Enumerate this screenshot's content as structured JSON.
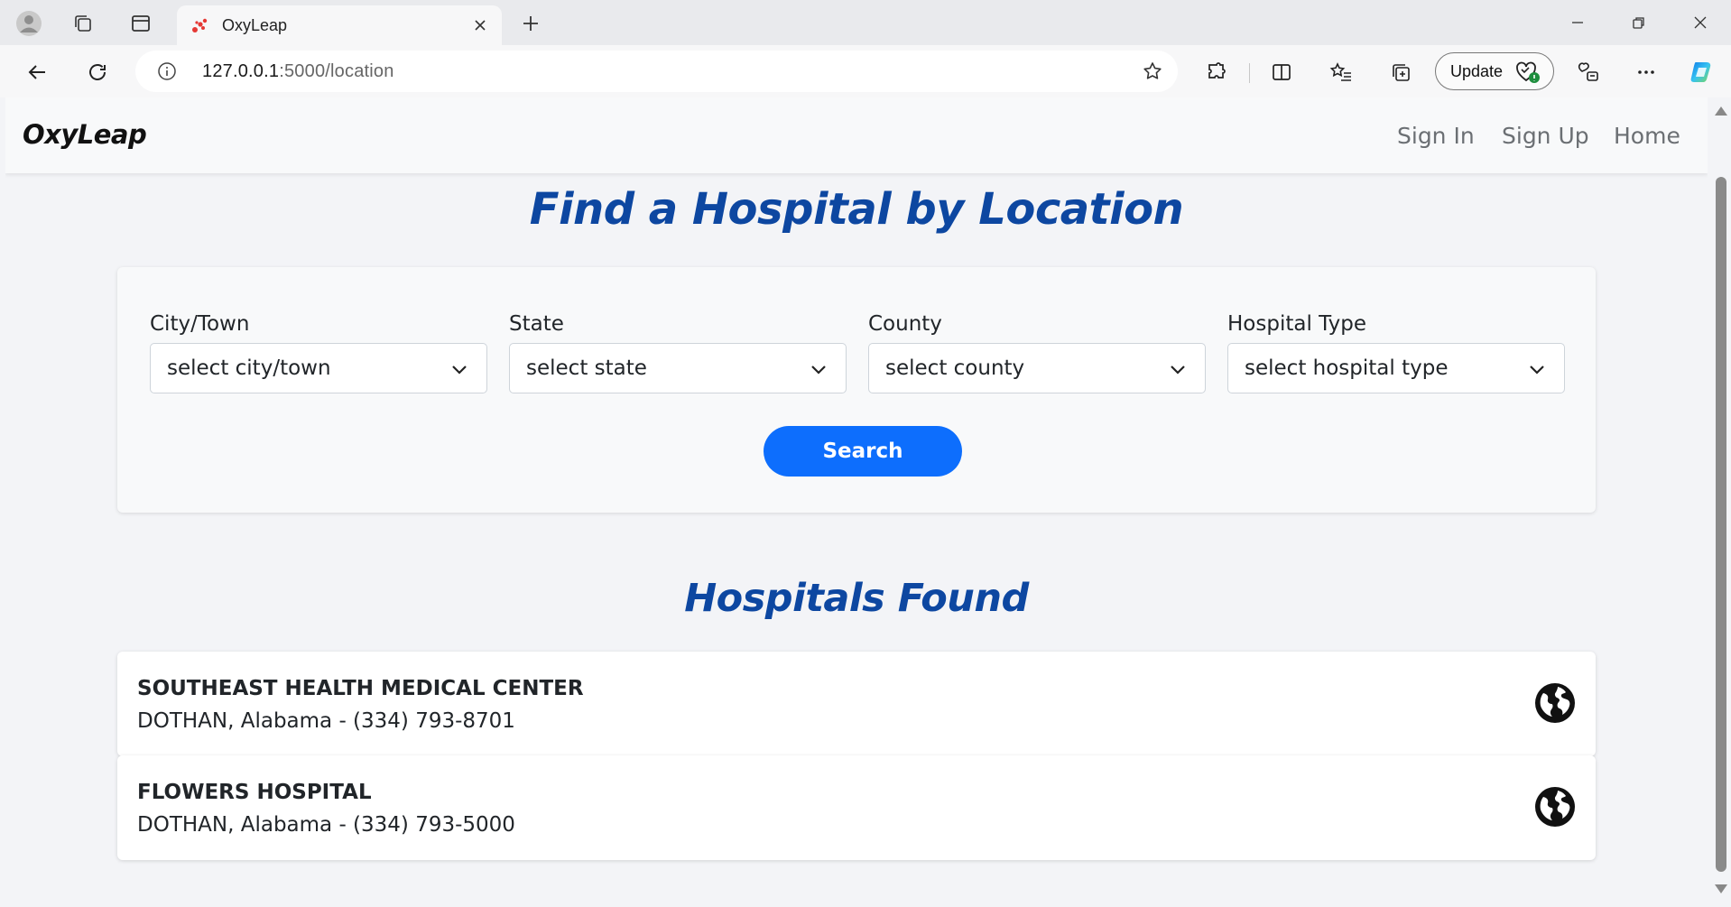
{
  "browser": {
    "tab_title": "OxyLeap",
    "url_host": "127.0.0.1",
    "url_path": ":5000/location",
    "update_label": "Update"
  },
  "navbar": {
    "brand": "OxyLeap",
    "links": [
      "Sign In",
      "Sign Up",
      "Home"
    ]
  },
  "page": {
    "title": "Find a Hospital by Location"
  },
  "search_form": {
    "fields": [
      {
        "label": "City/Town",
        "value": "select city/town"
      },
      {
        "label": "State",
        "value": "select state"
      },
      {
        "label": "County",
        "value": "select county"
      },
      {
        "label": "Hospital Type",
        "value": "select hospital type"
      }
    ],
    "button_label": "Search"
  },
  "results": {
    "title": "Hospitals Found",
    "items": [
      {
        "name": "SOUTHEAST HEALTH MEDICAL CENTER",
        "detail": "DOTHAN, Alabama - (334) 793-8701"
      },
      {
        "name": "FLOWERS HOSPITAL",
        "detail": "DOTHAN, Alabama - (334) 793-5000"
      }
    ]
  },
  "colors": {
    "accent": "#0d6efd",
    "heading": "#0d47a1"
  }
}
